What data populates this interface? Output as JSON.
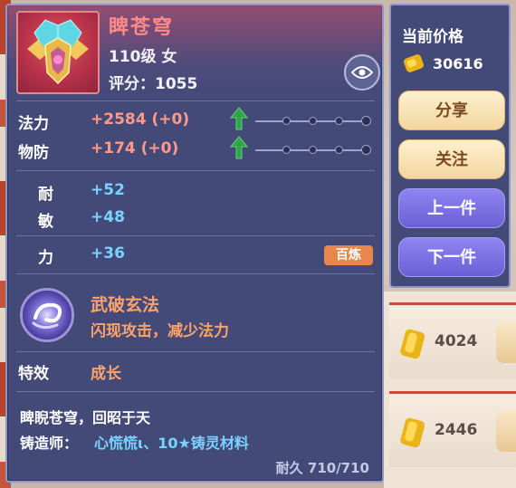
{
  "item": {
    "name": "睥苍穹",
    "level_gender": "110级 女",
    "score_text": "评分：1055"
  },
  "stats": [
    {
      "label": "法力",
      "value": "+2584 (+0)",
      "upgrade": true
    },
    {
      "label": "物防",
      "value": "+174 (+0)",
      "upgrade": true
    }
  ],
  "attributes": [
    {
      "label": "耐",
      "value": "+52"
    },
    {
      "label": "敏",
      "value": "+48"
    },
    {
      "label": "力",
      "value": "+36"
    }
  ],
  "badge": "百炼",
  "skill": {
    "name": "武破玄法",
    "description": "闪现攻击，减少法力"
  },
  "special": {
    "label": "特效",
    "value": "成长"
  },
  "flavor_text": "睥睨苍穹，回昭于天",
  "maker": {
    "label": "铸造师：",
    "value": "心慌慌ι、10★铸灵材料"
  },
  "durability": "耐久 710/710",
  "side_panel": {
    "price_title": "当前价格",
    "price_value": "30616",
    "buttons": [
      "分享",
      "关注",
      "上一件",
      "下一件"
    ]
  },
  "background_listings": [
    {
      "price": "4024"
    },
    {
      "price": "2446"
    }
  ],
  "colors": {
    "panel_bg": "#434a77",
    "name_color": "#ff8a8a",
    "stat_value_color": "#ff9a8a",
    "gain_color": "#7fe07f",
    "attr_color": "#79d2ff",
    "skill_color": "#ffa36b",
    "badge_color": "#e8874c"
  },
  "icons": {
    "item": "winged-crown-helmet-icon",
    "eye": "eye-icon",
    "upgrade": "green-up-arrow-icon",
    "skill": "swirl-orb-icon",
    "coin": "gold-ingot-icon"
  }
}
